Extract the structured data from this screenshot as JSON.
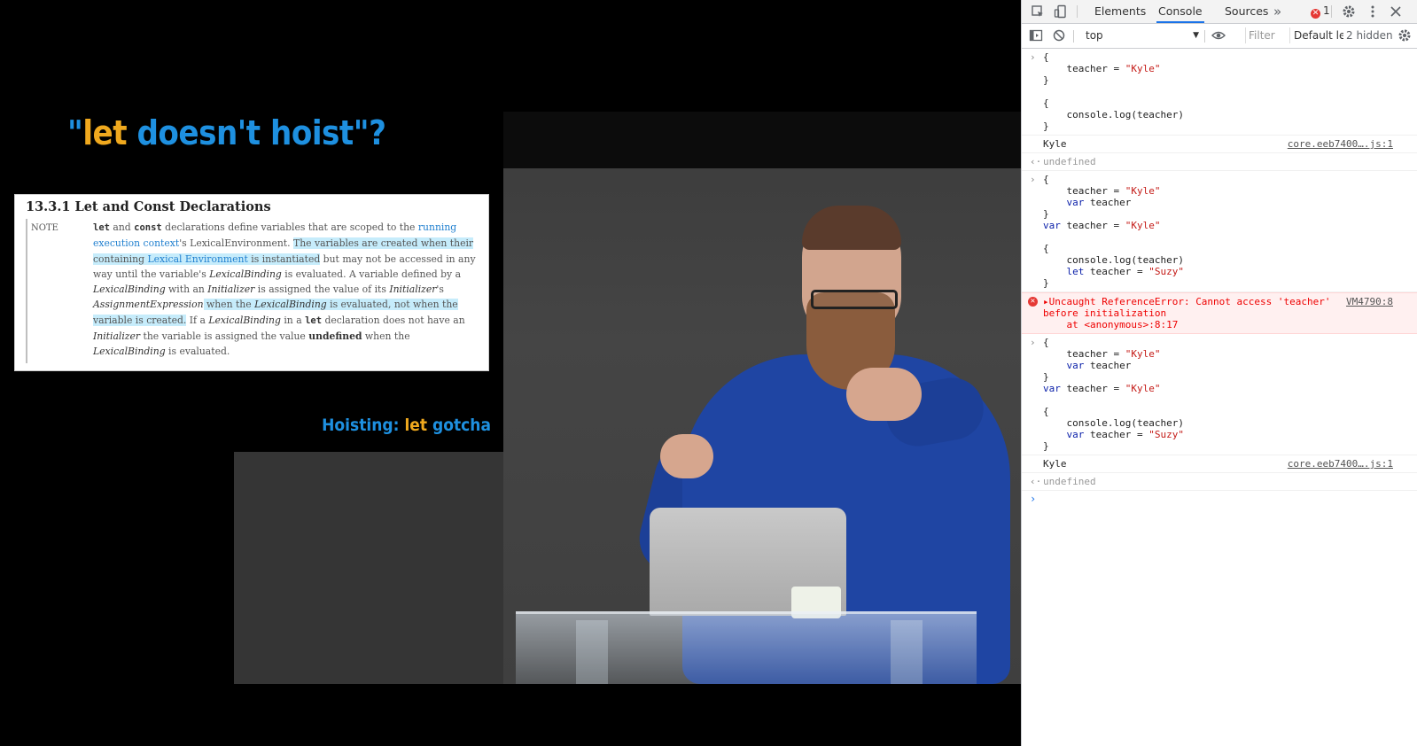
{
  "slide": {
    "title_quote_open": "\"",
    "title_kw": "let",
    "title_rest": " doesn't hoist",
    "title_quote_close": "\"?",
    "spec_heading": "13.3.1  Let and Const Declarations",
    "spec_note_label": "NOTE",
    "spec_text": {
      "p1_kw1": "let",
      "p1_and": " and ",
      "p1_kw2": "const",
      "p1_a": " declarations define variables that are scoped to the ",
      "p1_link1": "running execution context",
      "p1_b": "'s LexicalEnvironment. ",
      "p1_hl1_a": "The variables are created when their containing ",
      "p1_hl1_link": "Lexical Environment",
      "p1_hl1_b": " is instantiated",
      "p1_c": " but may not be accessed in any way until the variable's ",
      "p1_i1": "LexicalBinding",
      "p1_d": " is evaluated. A variable defined by a ",
      "p1_i2": "LexicalBinding",
      "p1_e": " with an ",
      "p1_i3": "Initializer",
      "p1_f": " is assigned the value of its ",
      "p1_i4": "Initializer",
      "p1_g": "'s ",
      "p1_i5": "AssignmentExpression",
      "p1_hl2_a": " when the ",
      "p1_hl2_i": "LexicalBinding",
      "p1_hl2_b": " is evaluated, not when the variable is created.",
      "p1_h": " If a ",
      "p1_i6": "LexicalBinding",
      "p1_j": " in a ",
      "p1_kw3": "let",
      "p1_k": " declaration does not have an ",
      "p1_i7": "Initializer",
      "p1_l": " the variable is assigned the value ",
      "p1_b1": "undefined",
      "p1_m": " when the ",
      "p1_i8": "LexicalBinding",
      "p1_n": " is evaluated."
    },
    "footer_a": "Hoisting: ",
    "footer_b": "let",
    "footer_c": " gotcha"
  },
  "video": {
    "laptop_logo": ""
  },
  "devtools": {
    "tabs": [
      "Elements",
      "Console",
      "Sources"
    ],
    "more_tabs": "»",
    "error_count": "1",
    "context": "top",
    "filter_placeholder": "Filter",
    "levels": "Default levels",
    "hidden": "2 hidden",
    "icons": {
      "inspect": "inspect-icon",
      "device": "device-toolbar-icon",
      "settings": "gear-icon",
      "menu": "kebab-menu-icon",
      "close": "close-icon"
    }
  },
  "console": {
    "entry1": {
      "l1": "{",
      "l2a": "    teacher = ",
      "l2s": "\"Kyle\"",
      "l3": "}",
      "l4": "",
      "l5": "{",
      "l6": "    console.log(teacher)",
      "l7": "}"
    },
    "log1": {
      "text": "Kyle",
      "source": "core.eeb7400….js:1"
    },
    "ret1": "undefined",
    "entry2": {
      "l1": "{",
      "l2a": "    teacher = ",
      "l2s": "\"Kyle\"",
      "l3k": "    var",
      "l3v": " teacher",
      "l4": "}",
      "l5k": "var",
      "l5v": " teacher = ",
      "l5s": "\"Kyle\"",
      "l6": "",
      "l7": "{",
      "l8": "    console.log(teacher)",
      "l9k": "    let",
      "l9v": " teacher = ",
      "l9s": "\"Suzy\"",
      "l10": "}"
    },
    "error": {
      "text": "Uncaught ReferenceError: Cannot access 'teacher'\nbefore initialization\n    at <anonymous>:8:17",
      "source": "VM4790:8"
    },
    "entry3": {
      "l1": "{",
      "l2a": "    teacher = ",
      "l2s": "\"Kyle\"",
      "l3k": "    var",
      "l3v": " teacher",
      "l4": "}",
      "l5k": "var",
      "l5v": " teacher = ",
      "l5s": "\"Kyle\"",
      "l6": "",
      "l7": "{",
      "l8": "    console.log(teacher)",
      "l9k": "    var",
      "l9v": " teacher = ",
      "l9s": "\"Suzy\"",
      "l10": "}"
    },
    "log2": {
      "text": "Kyle",
      "source": "core.eeb7400….js:1"
    },
    "ret2": "undefined",
    "prompt": "›"
  }
}
